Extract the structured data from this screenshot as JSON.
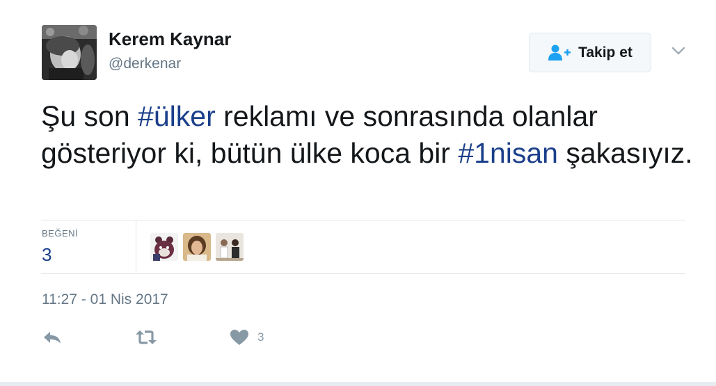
{
  "user": {
    "name": "Kerem Kaynar",
    "handle": "@derkenar",
    "avatar_icon": "user-avatar-photo"
  },
  "follow_button": {
    "label": "Takip et",
    "icon": "follow-user-icon"
  },
  "more_menu_icon": "chevron-down-icon",
  "tweet": {
    "text_parts": [
      "Şu son ",
      "#ülker",
      " reklamı ve sonrasında olanlar gösteriyor ki, bütün ülke koca bir ",
      "#1nisan",
      " şakasıyız."
    ]
  },
  "stats": {
    "likes_label": "BEĞENİ",
    "likes_count": "3",
    "liker_avatars": [
      "liker-avatar-1",
      "liker-avatar-2",
      "liker-avatar-3"
    ]
  },
  "timestamp": "11:27 - 01 Nis 2017",
  "actions": {
    "reply_icon": "reply-icon",
    "retweet_icon": "retweet-icon",
    "like_icon": "heart-icon",
    "like_count": "3"
  },
  "colors": {
    "hashtag": "#1b3f8a",
    "text": "#14171a",
    "muted": "#657786",
    "icon": "#8899a6",
    "follow_icon": "#1da1f2",
    "border": "#e1e8ed"
  }
}
